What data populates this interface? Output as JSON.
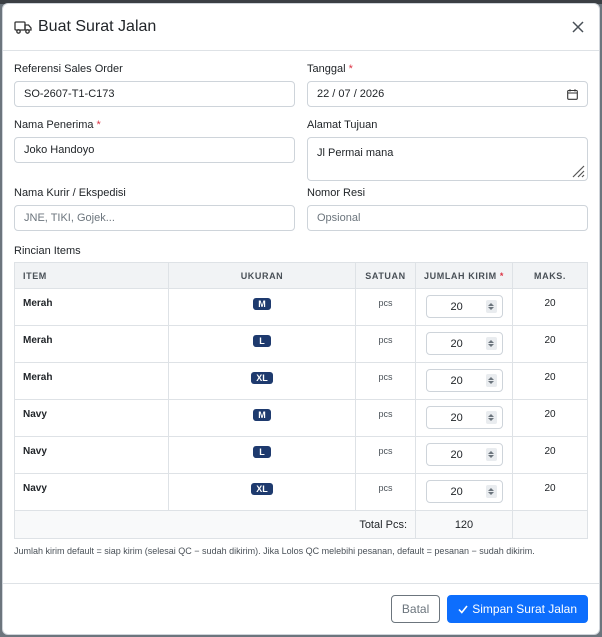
{
  "modal": {
    "title": "Buat Surat Jalan",
    "icon": "truck-icon",
    "close": "×"
  },
  "form": {
    "sales_order": {
      "label": "Referensi Sales Order",
      "value": "SO-2607-T1-C173"
    },
    "tanggal": {
      "label": "Tanggal",
      "required": "*",
      "value": "22 / 07 / 2026"
    },
    "nama_penerima": {
      "label": "Nama Penerima",
      "required": "*",
      "value": "Joko Handoyo"
    },
    "alamat_tujuan": {
      "label": "Alamat Tujuan",
      "value": "Jl Permai mana"
    },
    "kurir": {
      "label": "Nama Kurir / Ekspedisi",
      "placeholder": "JNE, TIKI, Gojek..."
    },
    "resi": {
      "label": "Nomor Resi",
      "placeholder": "Opsional"
    }
  },
  "items": {
    "title": "Rincian Items",
    "headers": {
      "item": "ITEM",
      "ukuran": "UKURAN",
      "satuan": "SATUAN",
      "jumlah": "JUMLAH KIRIM",
      "required": "*",
      "maks": "MAKS."
    },
    "rows": [
      {
        "item": "Merah",
        "size": "M",
        "unit": "pcs",
        "qty": "20",
        "max": "20"
      },
      {
        "item": "Merah",
        "size": "L",
        "unit": "pcs",
        "qty": "20",
        "max": "20"
      },
      {
        "item": "Merah",
        "size": "XL",
        "unit": "pcs",
        "qty": "20",
        "max": "20"
      },
      {
        "item": "Navy",
        "size": "M",
        "unit": "pcs",
        "qty": "20",
        "max": "20"
      },
      {
        "item": "Navy",
        "size": "L",
        "unit": "pcs",
        "qty": "20",
        "max": "20"
      },
      {
        "item": "Navy",
        "size": "XL",
        "unit": "pcs",
        "qty": "20",
        "max": "20"
      }
    ],
    "total_label": "Total Pcs:",
    "total_value": "120",
    "note": "Jumlah kirim default = siap kirim (selesai QC − sudah dikirim). Jika Lolos QC melebihi pesanan, default = pesanan − sudah dikirim."
  },
  "footer": {
    "cancel": "Batal",
    "submit": "Simpan Surat Jalan"
  },
  "colors": {
    "primary": "#0d6efd",
    "badge": "#1e3a6e",
    "required": "#dc3545"
  }
}
